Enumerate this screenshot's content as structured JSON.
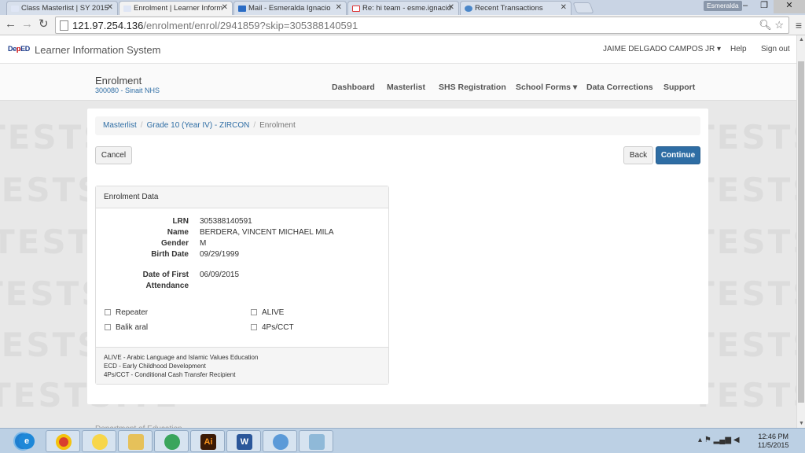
{
  "browser": {
    "tabs": [
      {
        "title": "Class Masterlist | SY 2015",
        "icon": "deped-favicon",
        "active": false
      },
      {
        "title": "Enrolment | Learner Inform",
        "icon": "deped-favicon",
        "active": true
      },
      {
        "title": "Mail - Esmeralda Ignacio",
        "icon": "mail-icon",
        "active": false
      },
      {
        "title": "Re: hi team - esme.ignacio",
        "icon": "gmail-icon",
        "active": false
      },
      {
        "title": "Recent Transactions",
        "icon": "globe-icon",
        "active": false
      }
    ],
    "profile_name": "Esmeralda",
    "url_host": "121.97.254.136",
    "url_path": "/enrolment/enrol/2941859?skip=305388140591"
  },
  "app": {
    "logo_text_blue": "De",
    "logo_text_red": "p",
    "logo_text_end": "ED",
    "title": "Learner Information System",
    "user": "JAIME DELGADO CAMPOS JR",
    "help": "Help",
    "signout": "Sign out"
  },
  "subnav": {
    "title": "Enrolment",
    "school": "300080 - Sinait NHS",
    "menu": [
      "Dashboard",
      "Masterlist",
      "SHS Registration",
      "School Forms",
      "Data Corrections",
      "Support"
    ]
  },
  "watermark": "TESTSITE",
  "breadcrumb": {
    "items": [
      "Masterlist",
      "Grade 10 (Year IV) - ZIRCON"
    ],
    "current": "Enrolment"
  },
  "buttons": {
    "cancel": "Cancel",
    "back": "Back",
    "continue": "Continue"
  },
  "panel": {
    "heading": "Enrolment Data",
    "fields": [
      {
        "label": "LRN",
        "value": "305388140591"
      },
      {
        "label": "Name",
        "value": "BERDERA, VINCENT MICHAEL MILA"
      },
      {
        "label": "Gender",
        "value": "M"
      },
      {
        "label": "Birth Date",
        "value": "09/29/1999"
      }
    ],
    "first_attendance_label_1": "Date of First",
    "first_attendance_label_2": "Attendance",
    "first_attendance_value": "06/09/2015",
    "checkboxes": [
      {
        "label": "Repeater",
        "checked": false
      },
      {
        "label": "ALIVE",
        "checked": false
      },
      {
        "label": "Balik aral",
        "checked": false
      },
      {
        "label": "4Ps/CCT",
        "checked": false
      }
    ],
    "legend": [
      "ALIVE - Arabic Language and Islamic Values Education",
      "ECD - Early Childhood Development",
      "4Ps/CCT - Conditional Cash Transfer Recipient"
    ]
  },
  "footer": "Department of Education",
  "taskbar": {
    "clock_time": "12:46 PM",
    "clock_date": "11/5/2015"
  }
}
